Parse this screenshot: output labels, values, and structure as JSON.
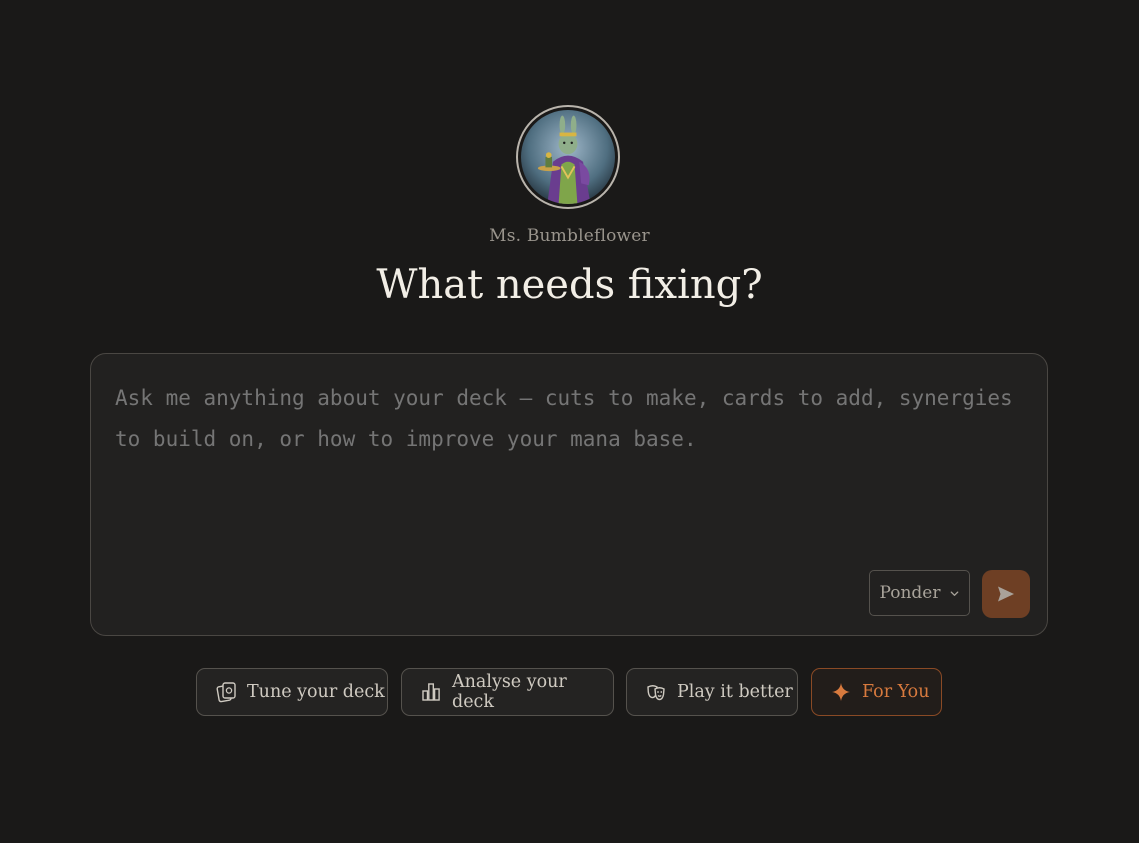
{
  "assistant": {
    "name": "Ms. Bumbleflower",
    "avatar_icon": "bunny-character-avatar"
  },
  "heading": "What needs fixing?",
  "composer": {
    "placeholder": "Ask me anything about your deck — cuts to make, cards to add, synergies to build on, or how to improve your mana base.",
    "value": "",
    "mode": {
      "selected": "Ponder",
      "icon": "chevron-down-icon"
    },
    "send_icon": "send-icon"
  },
  "suggestions": [
    {
      "label": "Tune your deck",
      "icon": "card-tune-icon"
    },
    {
      "label": "Analyse your deck",
      "icon": "bar-chart-icon"
    },
    {
      "label": "Play it better",
      "icon": "theater-masks-icon"
    },
    {
      "label": "For You",
      "icon": "sparkle-icon"
    }
  ],
  "colors": {
    "background": "#1a1918",
    "accent": "#d87a3e",
    "send_button": "#6e3f24"
  }
}
